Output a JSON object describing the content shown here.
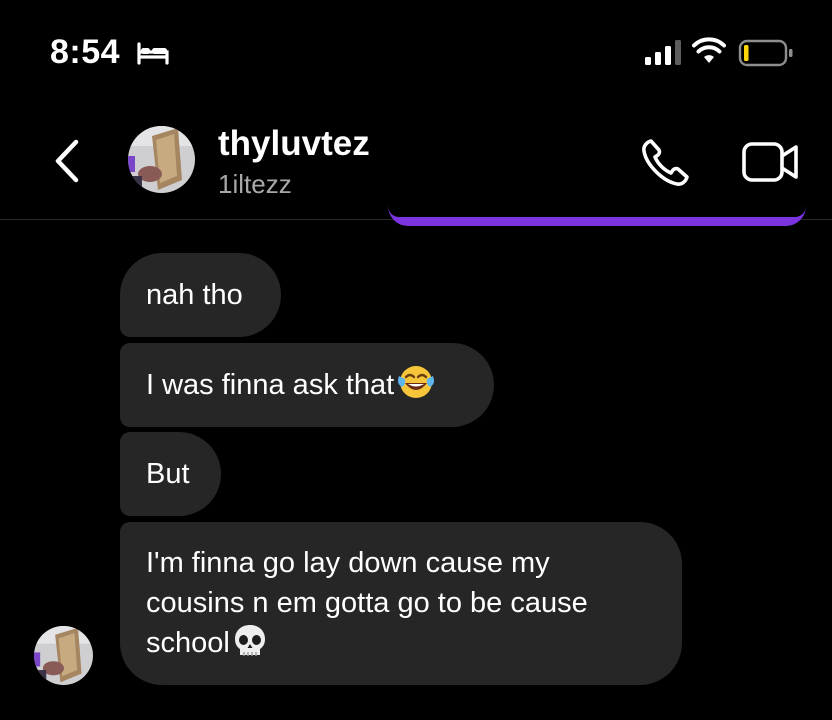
{
  "status_bar": {
    "time": "8:54",
    "sleep_focus_icon": "bed-icon",
    "signal_icon": "cellular-signal-icon",
    "wifi_icon": "wifi-icon",
    "battery_icon": "battery-low-icon",
    "battery_color": "#ffd60a"
  },
  "header": {
    "back_icon": "chevron-left-icon",
    "display_name": "thyluvtez",
    "username": "1iltezz",
    "call_icon": "phone-icon",
    "video_icon": "video-camera-icon"
  },
  "messages": [
    {
      "text": "nah tho",
      "emoji": ""
    },
    {
      "text": "I was finna ask that",
      "emoji": "face-with-tears-of-joy"
    },
    {
      "text": "But",
      "emoji": ""
    },
    {
      "text": "I'm finna go lay down cause my cousins n em gotta go to be cause school",
      "emoji": "skull"
    }
  ],
  "colors": {
    "background": "#000000",
    "received_bubble": "#262626",
    "sent_bubble": "#7b34e0",
    "secondary_text": "#a8a8a8"
  }
}
